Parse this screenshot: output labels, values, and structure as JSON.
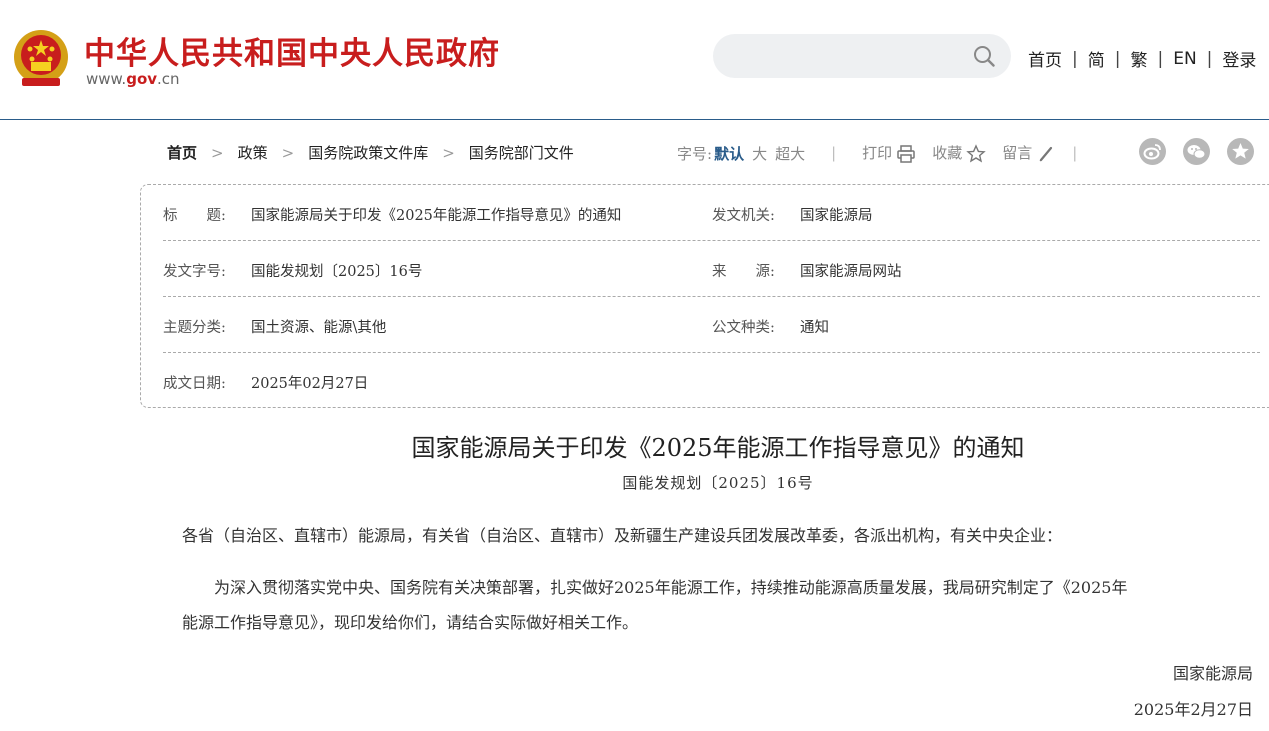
{
  "header": {
    "site_name": "中华人民共和国中央人民政府",
    "url_prefix": "www.",
    "url_gov": "gov",
    "url_suffix": ".cn",
    "search_placeholder": "",
    "nav": [
      "首页",
      "简",
      "繁",
      "EN",
      "登录"
    ]
  },
  "breadcrumb": {
    "items": [
      "首页",
      "政策",
      "国务院政策文件库",
      "国务院部门文件"
    ],
    "separator": ">"
  },
  "tools": {
    "font_size_label": "字号:",
    "font_default": "默认",
    "font_large": "大",
    "font_xlarge": "超大",
    "print": "打印",
    "favorite": "收藏",
    "comment": "留言"
  },
  "social": [
    "weibo-icon",
    "wechat-icon",
    "qzone-icon"
  ],
  "metadata": {
    "title_label": "标　　题:",
    "title_value": "国家能源局关于印发《2025年能源工作指导意见》的通知",
    "issuer_label": "发文机关:",
    "issuer_value": "国家能源局",
    "docno_label": "发文字号:",
    "docno_value": "国能发规划〔2025〕16号",
    "source_label": "来　　源:",
    "source_value": "国家能源局网站",
    "topic_label": "主题分类:",
    "topic_value": "国土资源、能源\\其他",
    "doctype_label": "公文种类:",
    "doctype_value": "通知",
    "date_label": "成文日期:",
    "date_value": "2025年02月27日"
  },
  "article": {
    "title": "国家能源局关于印发《2025年能源工作指导意见》的通知",
    "doc_number": "国能发规划〔2025〕16号",
    "salutation": "各省（自治区、直辖市）能源局，有关省（自治区、直辖市）及新疆生产建设兵团发展改革委，各派出机构，有关中央企业：",
    "body_line1": "　　为深入贯彻落实党中央、国务院有关决策部署，扎实做好2025年能源工作，持续推动能源高质量发展，我局研究制定了《2025年",
    "body_line2": "能源工作指导意见》，现印发给你们，请结合实际做好相关工作。",
    "signature": "国家能源局",
    "sign_date": "2025年2月27日"
  },
  "colors": {
    "brand_red": "#c81d1d",
    "accent_blue": "#2a5c8a"
  }
}
